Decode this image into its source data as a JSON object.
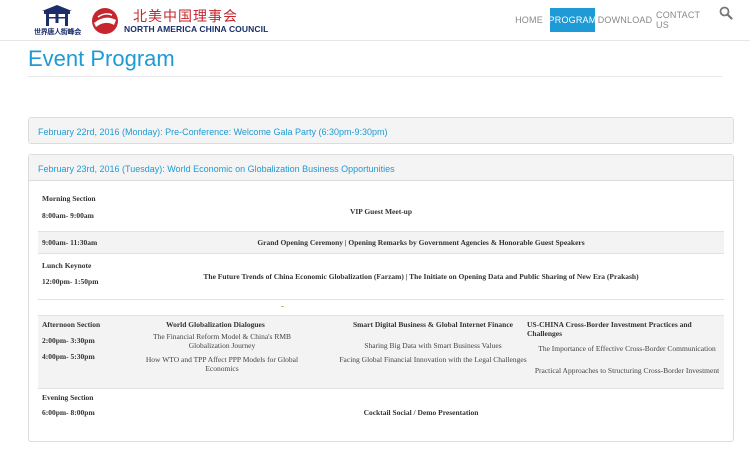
{
  "header": {
    "logo_caption": "世界唐人街峰会",
    "brand_cn": "北美中国理事会",
    "brand_en": "North America China Council",
    "nav": [
      {
        "label": "HOME",
        "active": false
      },
      {
        "label": "PROGRAM",
        "active": true
      },
      {
        "label": "DOWNLOAD",
        "active": false
      },
      {
        "label": "CONTACT US",
        "active": false
      }
    ],
    "search_icon": "search-icon",
    "accent_color": "#1e9ad6"
  },
  "page": {
    "title": "Event Program"
  },
  "panels": [
    {
      "heading": "February 22rd, 2016 (Monday): Pre-Conference: Welcome Gala Party (6:30pm-9:30pm)"
    },
    {
      "heading": "February 23rd, 2016 (Tuesday): World Economic on Globalization Business Opportunities"
    }
  ],
  "schedule": {
    "morning": {
      "section": "Morning Section",
      "time": "8:00am- 9:00am",
      "event": "VIP Guest Meet-up"
    },
    "opening": {
      "time": "9:00am- 11:30am",
      "event": "Grand Opening Ceremony | Opening Remarks by Government Agencies & Honorable Guest Speakers"
    },
    "lunch": {
      "section": "Lunch Keynote",
      "time": "12:00pm- 1:50pm",
      "event": "The Future Trends of China Economic Globalization (Farzam) | The Initiate on Opening Data and Public Sharing of New Era (Prakash)"
    },
    "afternoon": {
      "section": "Afternoon Section",
      "time1": "2:00pm- 3:30pm",
      "time2": "4:00pm- 5:30pm",
      "tracks": [
        {
          "title": "World Globalization Dialogues",
          "item1": "The Financial Reform Model & China's RMB Globalization Journey",
          "item2": "How WTO and TPP Affect PPP Models for Global Economics"
        },
        {
          "title": "Smart Digital Business & Global Internet Finance",
          "item1": "Sharing Big Data with Smart Business Values",
          "item2": "Facing Global Financial Innovation with the Legal Challenges"
        },
        {
          "title": "US-CHINA Cross-Border Investment Practices and Challenges",
          "item1": "The Importance of Effective Cross-Border Communication",
          "item2": "Practical Approaches to Structuring Cross-Border Investment"
        }
      ]
    },
    "evening": {
      "section": "Evening Section",
      "time": "6:00pm- 8:00pm",
      "event": "Cocktail Social / Demo Presentation"
    }
  }
}
